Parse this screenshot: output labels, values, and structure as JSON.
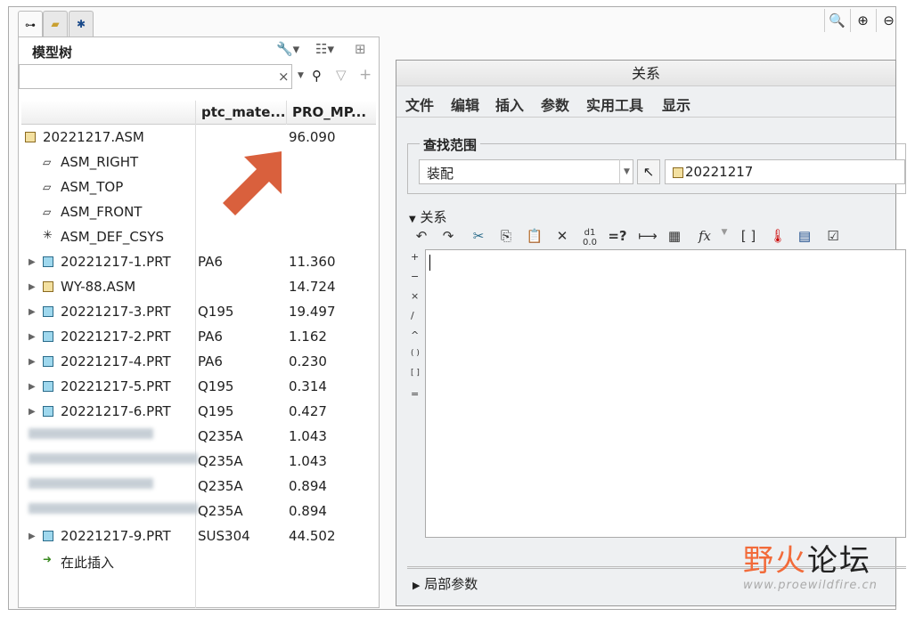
{
  "left_tabs": [
    "model-tree",
    "folder-browser",
    "favorites"
  ],
  "model_tree": {
    "title": "模型树",
    "search_placeholder": "",
    "columns": [
      "ptc_mate...",
      "PRO_MP..."
    ],
    "rows": [
      {
        "name": "20221217.ASM",
        "material": "",
        "mass": "96.090",
        "icon": "assembly",
        "expand": false,
        "indent": 0
      },
      {
        "name": "ASM_RIGHT",
        "material": "",
        "mass": "",
        "icon": "datum-plane",
        "expand": false,
        "indent": 1
      },
      {
        "name": "ASM_TOP",
        "material": "",
        "mass": "",
        "icon": "datum-plane",
        "expand": false,
        "indent": 1
      },
      {
        "name": "ASM_FRONT",
        "material": "",
        "mass": "",
        "icon": "datum-plane",
        "expand": false,
        "indent": 1
      },
      {
        "name": "ASM_DEF_CSYS",
        "material": "",
        "mass": "",
        "icon": "csys",
        "expand": false,
        "indent": 1
      },
      {
        "name": "20221217-1.PRT",
        "material": "PA6",
        "mass": "11.360",
        "icon": "part",
        "expand": true,
        "indent": 1
      },
      {
        "name": "WY-88.ASM",
        "material": "",
        "mass": "14.724",
        "icon": "assembly",
        "expand": true,
        "indent": 1
      },
      {
        "name": "20221217-3.PRT",
        "material": "Q195",
        "mass": "19.497",
        "icon": "part",
        "expand": true,
        "indent": 1
      },
      {
        "name": "20221217-2.PRT",
        "material": "PA6",
        "mass": "1.162",
        "icon": "part",
        "expand": true,
        "indent": 1
      },
      {
        "name": "20221217-4.PRT",
        "material": "PA6",
        "mass": "0.230",
        "icon": "part",
        "expand": true,
        "indent": 1
      },
      {
        "name": "20221217-5.PRT",
        "material": "Q195",
        "mass": "0.314",
        "icon": "part",
        "expand": true,
        "indent": 1
      },
      {
        "name": "20221217-6.PRT",
        "material": "Q195",
        "mass": "0.427",
        "icon": "part",
        "expand": true,
        "indent": 1
      },
      {
        "name": "",
        "material": "Q235A",
        "mass": "1.043",
        "icon": "blurred",
        "expand": false,
        "indent": 1
      },
      {
        "name": "",
        "material": "Q235A",
        "mass": "1.043",
        "icon": "blurred",
        "expand": false,
        "indent": 1
      },
      {
        "name": "",
        "material": "Q235A",
        "mass": "0.894",
        "icon": "blurred",
        "expand": false,
        "indent": 1
      },
      {
        "name": "",
        "material": "Q235A",
        "mass": "0.894",
        "icon": "blurred",
        "expand": false,
        "indent": 1
      },
      {
        "name": "20221217-9.PRT",
        "material": "SUS304",
        "mass": "44.502",
        "icon": "part",
        "expand": true,
        "indent": 1
      },
      {
        "name": "在此插入",
        "material": "",
        "mass": "",
        "icon": "insert-arrow",
        "expand": false,
        "indent": 1
      }
    ]
  },
  "dialog": {
    "title": "关系",
    "menus": [
      "文件",
      "编辑",
      "插入",
      "参数",
      "实用工具",
      "显示"
    ],
    "scope_label": "查找范围",
    "scope_value": "装配",
    "model_value": "20221217",
    "relations_label": "关系",
    "local_params_label": "局部参数",
    "editor_text": "",
    "symbols": [
      "+",
      "−",
      "×",
      "/",
      "^",
      "( )",
      "[ ]",
      "="
    ]
  },
  "watermark": {
    "text": "野火论坛",
    "url": "www.proewildfire.cn",
    "color": "#f26b3a"
  }
}
